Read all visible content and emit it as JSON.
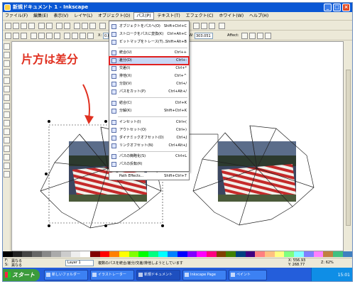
{
  "window": {
    "title": "新規ドキュメント 1 - Inkscape"
  },
  "menubar": [
    "ファイル(F)",
    "編集(E)",
    "表示(V)",
    "レイヤ(L)",
    "オブジェクト(O)",
    "パス(P)",
    "テキスト(T)",
    "エフェクト(C)",
    "ホワイト(W)",
    "ヘルプ(H)"
  ],
  "toolbar2": {
    "x_label": "X:",
    "x_value": "0.0",
    "w_label": "W:",
    "w_value": "303.051",
    "affect_label": "Affect:"
  },
  "annotation": "片方は差分",
  "path_menu": {
    "items": [
      {
        "label": "オブジェクトをパスへ(O)",
        "shortcut": "Shift+Ctrl+C"
      },
      {
        "label": "ストロークをパスに変換(K)",
        "shortcut": "Ctrl+Alt+C"
      },
      {
        "label": "ビットマップをトレース(T)...",
        "shortcut": "Shift+Alt+B"
      },
      {
        "label": "統合(U)",
        "shortcut": "Ctrl++"
      },
      {
        "label": "差分(D)",
        "shortcut": "Ctrl+-"
      },
      {
        "label": "交差(I)",
        "shortcut": "Ctrl+*"
      },
      {
        "label": "排他(X)",
        "shortcut": "Ctrl+^"
      },
      {
        "label": "分割(V)",
        "shortcut": "Ctrl+/"
      },
      {
        "label": "パスをカット(P)",
        "shortcut": "Ctrl+Alt+/"
      },
      {
        "label": "結合(C)",
        "shortcut": "Ctrl+K"
      },
      {
        "label": "分解(K)",
        "shortcut": "Shift+Ctrl+K"
      },
      {
        "label": "インセット(I)",
        "shortcut": "Ctrl+("
      },
      {
        "label": "アウトセット(O)",
        "shortcut": "Ctrl+)"
      },
      {
        "label": "ダイナミックオフセット(D)",
        "shortcut": "Ctrl+J"
      },
      {
        "label": "リンクオフセット(N)",
        "shortcut": "Ctrl+Alt+J"
      },
      {
        "label": "パスの簡略化(S)",
        "shortcut": "Ctrl+L"
      },
      {
        "label": "パスの反転(R)",
        "shortcut": ""
      },
      {
        "label": "Path Effects...",
        "shortcut": "Shift+Ctrl+7"
      }
    ],
    "highlighted_index": 4
  },
  "statusbar": {
    "fill_label": "F:",
    "stroke_label": "S:",
    "fill_value": "異なる",
    "stroke_value": "異なる",
    "layer": "Layer 1",
    "message": "複数のパスを統合/差分/交差/排他しようとしています",
    "x": "X: 556.93",
    "y": "Y: 268.77",
    "zoom": "Z: 62%"
  },
  "taskbar": {
    "start_label": "スタート",
    "tasks": [
      "新しいフォルダー",
      "イラストレーター",
      "新規ドキュメント",
      "Inkscape Page",
      "ペイント"
    ],
    "clock": "15:01"
  },
  "colors": {
    "accent": "#0a57d4",
    "annotation": "#e03020",
    "highlight": "#e02020"
  }
}
